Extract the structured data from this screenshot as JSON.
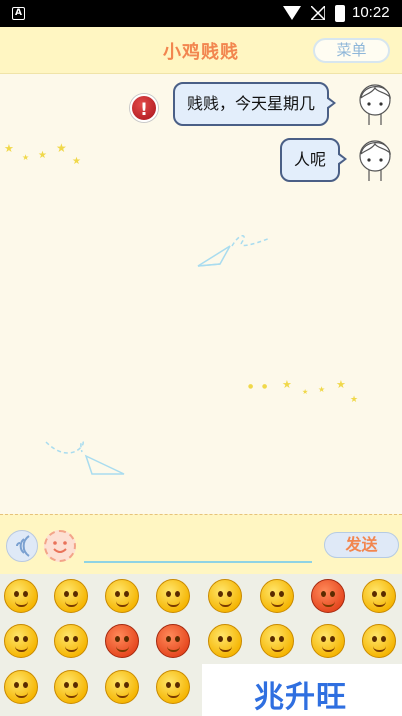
{
  "status_bar": {
    "time": "10:22",
    "app_icon": "A"
  },
  "header": {
    "title": "小鸡贱贱",
    "menu_label": "菜单"
  },
  "messages": [
    {
      "text": "贱贱，今天星期几",
      "status": "error"
    },
    {
      "text": "人呢"
    }
  ],
  "input": {
    "value": "",
    "placeholder": "",
    "send_label": "发送"
  },
  "emoji_panel": {
    "rows": [
      [
        "smile-emoji",
        "blush-emoji",
        "heart-eyes-emoji",
        "surprised-emoji",
        "cool-emoji",
        "crying-emoji",
        "love-emoji",
        "zipped-emoji"
      ],
      [
        "smirk-emoji",
        "laughing-tears-emoji",
        "angry-emoji",
        "furious-emoji",
        "wink-emoji",
        "grin-emoji",
        "sweat-emoji",
        "sad-emoji"
      ],
      [
        "sunglasses-emoji",
        "shy-emoji",
        "laughing-emoji",
        "dizzy-emoji"
      ]
    ],
    "page_count": 2,
    "current_page": 1
  },
  "watermark": {
    "text": "兆升旺"
  },
  "colors": {
    "header_bg": "#fff6c2",
    "chat_bg": "#fdf9ea",
    "title": "#f2864f",
    "bubble": "#e3eefb",
    "bubble_border": "#4a5f86"
  }
}
